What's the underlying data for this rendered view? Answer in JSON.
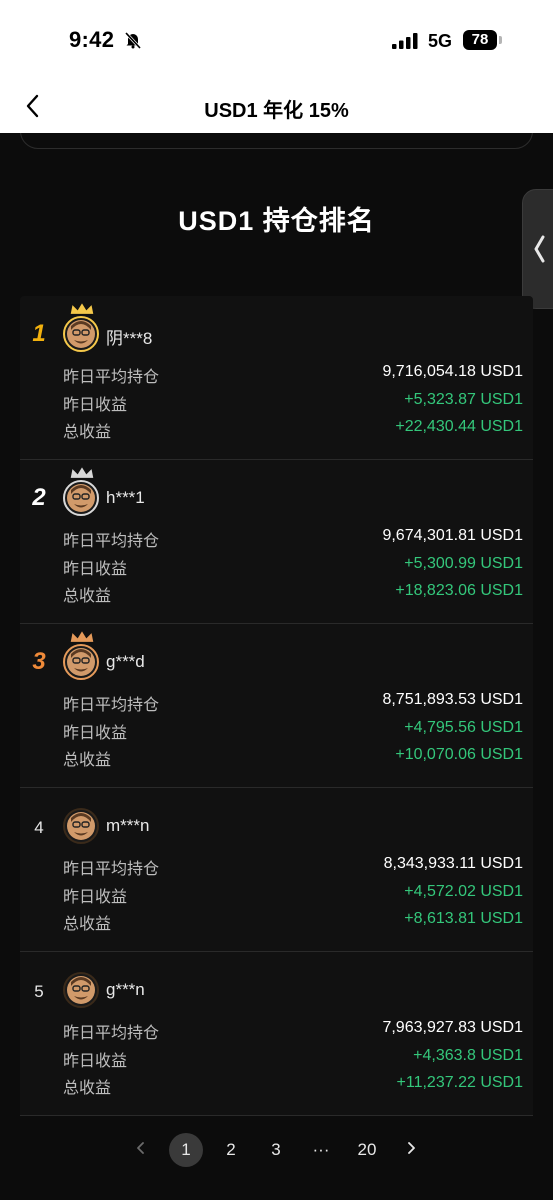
{
  "status": {
    "time": "9:42",
    "network": "5G",
    "battery": "78"
  },
  "nav": {
    "title": "USD1 年化 15%"
  },
  "section_title": "USD1 持仓排名",
  "labels": {
    "avg_holding": "昨日平均持仓",
    "yesterday_profit": "昨日收益",
    "total_profit": "总收益"
  },
  "ranking": [
    {
      "rank": "1",
      "name": "阴***8",
      "avg_holding": "9,716,054.18 USD1",
      "yesterday_profit": "+5,323.87 USD1",
      "total_profit": "+22,430.44 USD1",
      "crown": "gold-crown-icon"
    },
    {
      "rank": "2",
      "name": "h***1",
      "avg_holding": "9,674,301.81 USD1",
      "yesterday_profit": "+5,300.99 USD1",
      "total_profit": "+18,823.06 USD1",
      "crown": "silver-crown-icon"
    },
    {
      "rank": "3",
      "name": "g***d",
      "avg_holding": "8,751,893.53 USD1",
      "yesterday_profit": "+4,795.56 USD1",
      "total_profit": "+10,070.06 USD1",
      "crown": "bronze-crown-icon"
    },
    {
      "rank": "4",
      "name": "m***n",
      "avg_holding": "8,343,933.11 USD1",
      "yesterday_profit": "+4,572.02 USD1",
      "total_profit": "+8,613.81 USD1"
    },
    {
      "rank": "5",
      "name": "g***n",
      "avg_holding": "7,963,927.83 USD1",
      "yesterday_profit": "+4,363.8 USD1",
      "total_profit": "+11,237.22 USD1"
    }
  ],
  "pagination": {
    "pages": [
      "1",
      "2",
      "3",
      "···",
      "20"
    ],
    "current": "1"
  },
  "colors": {
    "gold": "#f2b10e",
    "bronze": "#ef8a39",
    "profit_green": "#34c77b",
    "background": "#0c0c0c"
  }
}
